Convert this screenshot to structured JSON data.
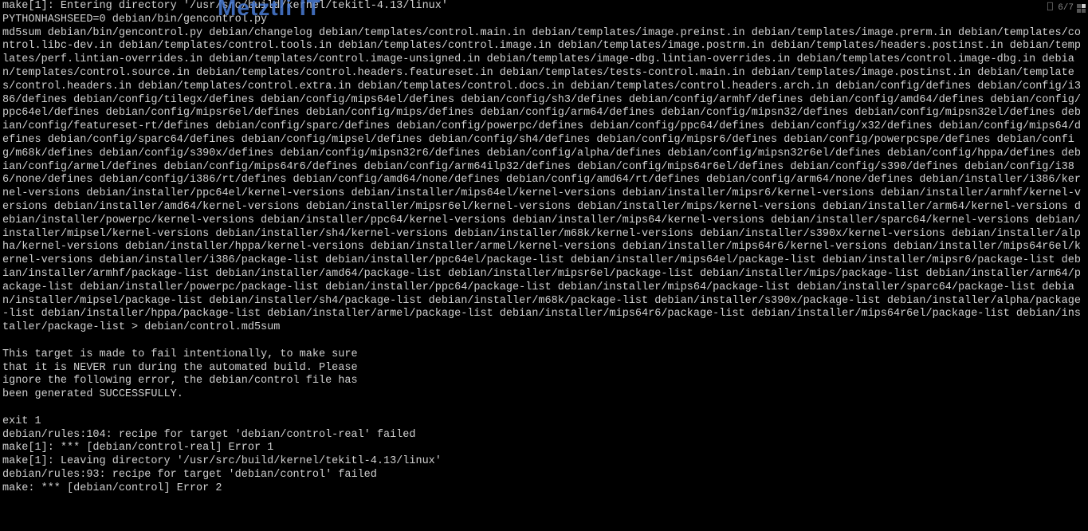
{
  "watermark": "Metztli IT",
  "status": {
    "pane_indicator": "6/7"
  },
  "terminal": {
    "lines": [
      "make[1]: Entering directory '/usr/src/build/kernel/tekitl-4.13/linux'",
      "PYTHONHASHSEED=0 debian/bin/gencontrol.py",
      "md5sum debian/bin/gencontrol.py debian/changelog debian/templates/control.main.in debian/templates/image.preinst.in debian/templates/image.prerm.in debian/templates/control.libc-dev.in debian/templates/control.tools.in debian/templates/control.image.in debian/templates/image.postrm.in debian/templates/headers.postinst.in debian/templates/perf.lintian-overrides.in debian/templates/control.image-unsigned.in debian/templates/image-dbg.lintian-overrides.in debian/templates/control.image-dbg.in debian/templates/control.source.in debian/templates/control.headers.featureset.in debian/templates/tests-control.main.in debian/templates/image.postinst.in debian/templates/control.headers.in debian/templates/control.extra.in debian/templates/control.docs.in debian/templates/control.headers.arch.in debian/config/defines debian/config/i386/defines debian/config/tilegx/defines debian/config/mips64el/defines debian/config/sh3/defines debian/config/armhf/defines debian/config/amd64/defines debian/config/ppc64el/defines debian/config/mipsr6el/defines debian/config/mips/defines debian/config/arm64/defines debian/config/mipsn32/defines debian/config/mipsn32el/defines debian/config/featureset-rt/defines debian/config/sparc/defines debian/config/powerpc/defines debian/config/ppc64/defines debian/config/x32/defines debian/config/mips64/defines debian/config/sparc64/defines debian/config/mipsel/defines debian/config/sh4/defines debian/config/mipsr6/defines debian/config/powerpcspe/defines debian/config/m68k/defines debian/config/s390x/defines debian/config/mipsn32r6/defines debian/config/alpha/defines debian/config/mipsn32r6el/defines debian/config/hppa/defines debian/config/armel/defines debian/config/mips64r6/defines debian/config/arm64ilp32/defines debian/config/mips64r6el/defines debian/config/s390/defines debian/config/i386/none/defines debian/config/i386/rt/defines debian/config/amd64/none/defines debian/config/amd64/rt/defines debian/config/arm64/none/defines debian/installer/i386/kernel-versions debian/installer/ppc64el/kernel-versions debian/installer/mips64el/kernel-versions debian/installer/mipsr6/kernel-versions debian/installer/armhf/kernel-versions debian/installer/amd64/kernel-versions debian/installer/mipsr6el/kernel-versions debian/installer/mips/kernel-versions debian/installer/arm64/kernel-versions debian/installer/powerpc/kernel-versions debian/installer/ppc64/kernel-versions debian/installer/mips64/kernel-versions debian/installer/sparc64/kernel-versions debian/installer/mipsel/kernel-versions debian/installer/sh4/kernel-versions debian/installer/m68k/kernel-versions debian/installer/s390x/kernel-versions debian/installer/alpha/kernel-versions debian/installer/hppa/kernel-versions debian/installer/armel/kernel-versions debian/installer/mips64r6/kernel-versions debian/installer/mips64r6el/kernel-versions debian/installer/i386/package-list debian/installer/ppc64el/package-list debian/installer/mips64el/package-list debian/installer/mipsr6/package-list debian/installer/armhf/package-list debian/installer/amd64/package-list debian/installer/mipsr6el/package-list debian/installer/mips/package-list debian/installer/arm64/package-list debian/installer/powerpc/package-list debian/installer/ppc64/package-list debian/installer/mips64/package-list debian/installer/sparc64/package-list debian/installer/mipsel/package-list debian/installer/sh4/package-list debian/installer/m68k/package-list debian/installer/s390x/package-list debian/installer/alpha/package-list debian/installer/hppa/package-list debian/installer/armel/package-list debian/installer/mips64r6/package-list debian/installer/mips64r6el/package-list debian/installer/package-list > debian/control.md5sum",
      "",
      "This target is made to fail intentionally, to make sure",
      "that it is NEVER run during the automated build. Please",
      "ignore the following error, the debian/control file has",
      "been generated SUCCESSFULLY.",
      "",
      "exit 1",
      "debian/rules:104: recipe for target 'debian/control-real' failed",
      "make[1]: *** [debian/control-real] Error 1",
      "make[1]: Leaving directory '/usr/src/build/kernel/tekitl-4.13/linux'",
      "debian/rules:93: recipe for target 'debian/control' failed",
      "make: *** [debian/control] Error 2"
    ]
  }
}
